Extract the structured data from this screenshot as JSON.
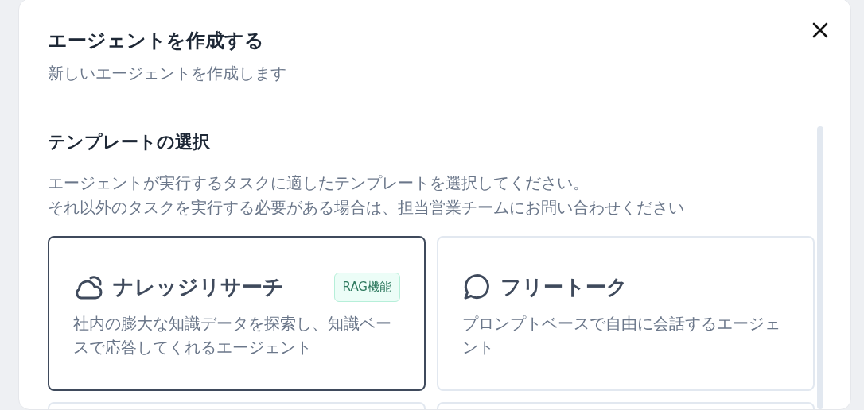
{
  "dialog": {
    "title": "エージェントを作成する",
    "subtitle": "新しいエージェントを作成します"
  },
  "section": {
    "heading": "テンプレートの選択",
    "description": [
      "エージェントが実行するタスクに適したテンプレートを選択してください。",
      "それ以外のタスクを実行する必要がある場合は、担当営業チームにお問い合わせください"
    ]
  },
  "templates": [
    {
      "kind": "cloud",
      "title": "ナレッジリサーチ",
      "badge": "RAG機能",
      "description": "社内の膨大な知識データを探索し、知識ベースで応答してくれるエージェント",
      "selected": true
    },
    {
      "kind": "chat",
      "title": "フリートーク",
      "description": "プロンプトベースで自由に会話するエージェント",
      "selected": false
    },
    {
      "selected": false
    },
    {
      "selected": false
    }
  ]
}
